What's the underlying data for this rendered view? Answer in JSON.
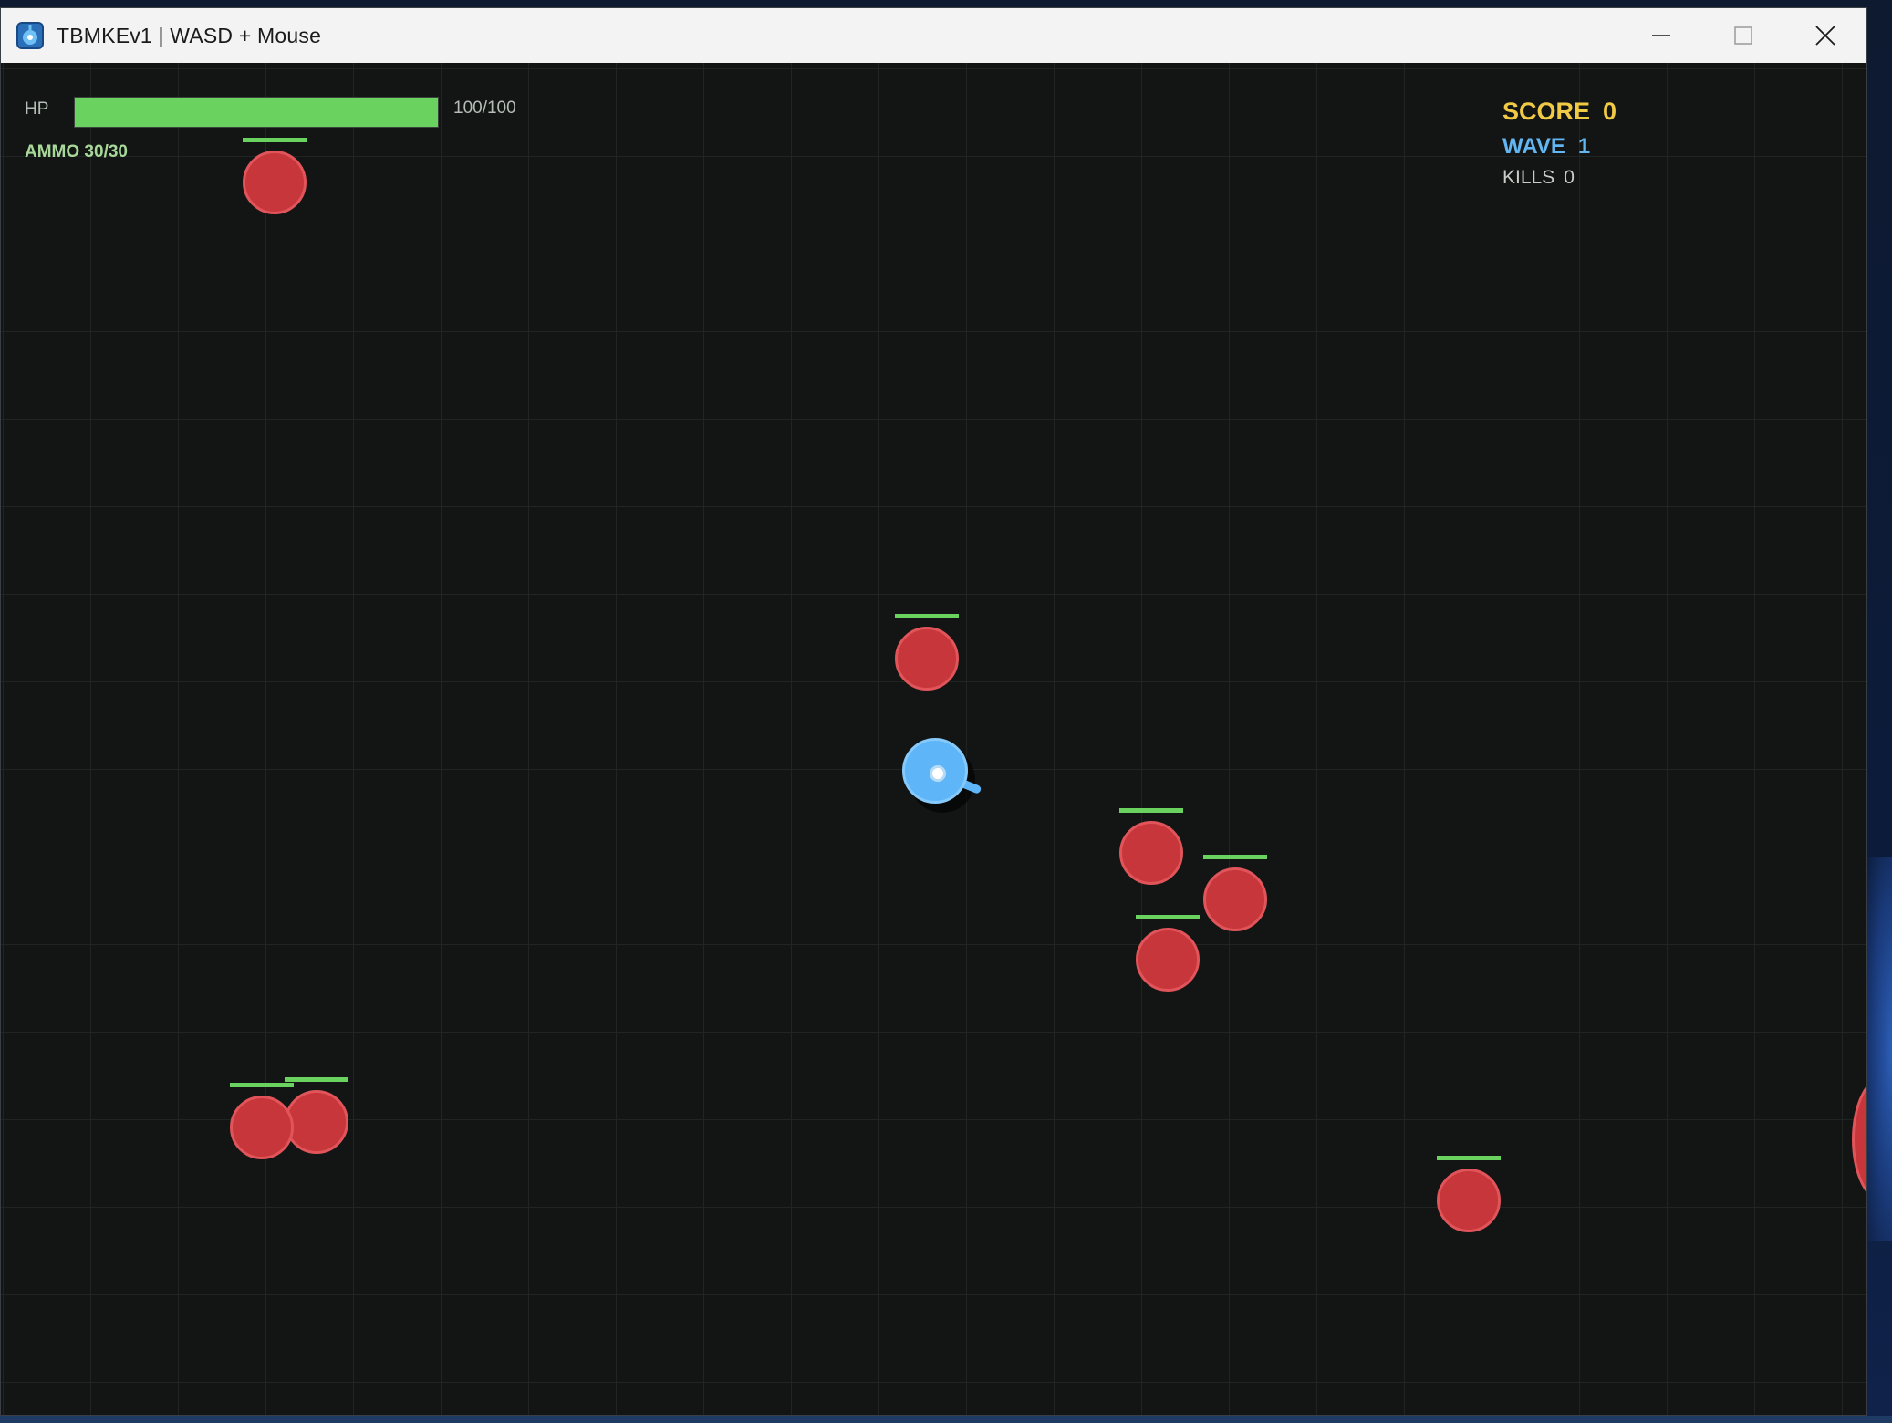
{
  "window": {
    "title": "TBMKEv1 | WASD + Mouse",
    "app_icon": "robot-app-icon",
    "controls": [
      "minimize-icon",
      "maximize-icon",
      "close-icon"
    ]
  },
  "hud": {
    "hp_label": "HP",
    "hp_text": "100/100",
    "hp_fraction": 1.0,
    "ammo_text": "AMMO 30/30",
    "score_label": "SCORE",
    "score_value": "0",
    "wave_label": "WAVE",
    "wave_value": "1",
    "kills_label": "KILLS",
    "kills_value": "0"
  },
  "colors": {
    "background": "#131514",
    "grid": "#202521",
    "hp_bar": "#6ad35f",
    "enemy": "#c6363a",
    "player": "#5eb5f7",
    "score": "#f1ca45",
    "wave": "#62b7f3",
    "ammo": "#a8d99a"
  },
  "enemies_count": 9
}
